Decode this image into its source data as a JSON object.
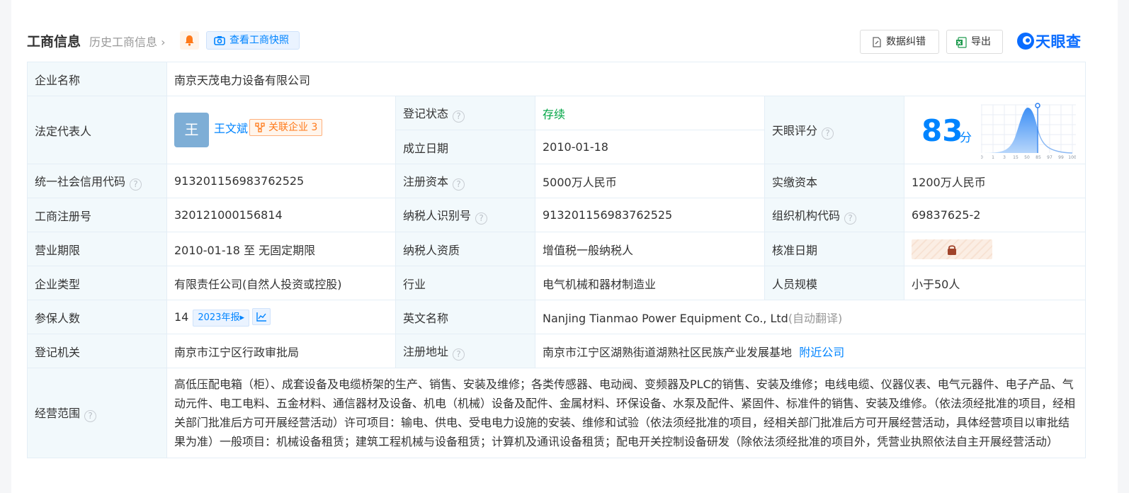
{
  "header": {
    "title": "工商信息",
    "history_link": "历史工商信息",
    "quick_view_label": "查看工商快照",
    "correct_label": "数据纠错",
    "export_label": "导出",
    "brand_name": "天眼查",
    "bell_icon": "bell-icon",
    "camera_icon": "camera-icon"
  },
  "rows": {
    "company_name": {
      "label": "企业名称",
      "value": "南京天茂电力设备有限公司"
    },
    "legal_rep": {
      "label": "法定代表人",
      "avatar_text": "王",
      "name": "王文斌",
      "related_label": "关联企业",
      "related_count": "3"
    },
    "reg_status": {
      "label": "登记状态",
      "value": "存续"
    },
    "found_date": {
      "label": "成立日期",
      "value": "2010-01-18"
    },
    "tianyan_score": {
      "label": "天眼评分",
      "score": "83",
      "unit": "分",
      "axis_ticks": [
        "0",
        "1",
        "3",
        "15",
        "50",
        "85",
        "97",
        "99",
        "100"
      ]
    },
    "credit_code": {
      "label": "统一社会信用代码",
      "value": "91320115698376252​5"
    },
    "reg_capital": {
      "label": "注册资本",
      "value": "5000万人民币"
    },
    "paid_capital": {
      "label": "实缴资本",
      "value": "1200万人民币"
    },
    "biz_reg_no": {
      "label": "工商注册号",
      "value": "320121000156814"
    },
    "taxpayer_id": {
      "label": "纳税人识别号",
      "value": "913201156983762525"
    },
    "org_code": {
      "label": "组织机构代码",
      "value": "69837625-2"
    },
    "biz_term": {
      "label": "营业期限",
      "value": "2010-01-18 至 无固定期限"
    },
    "taxpayer_qual": {
      "label": "纳税人资质",
      "value": "增值税一般纳税人"
    },
    "approve_date": {
      "label": "核准日期",
      "lock_icon": "lock-icon"
    },
    "company_type": {
      "label": "企业类型",
      "value": "有限责任公司(自然人投资或控股)"
    },
    "industry": {
      "label": "行业",
      "value": "电气机械和器材制造业"
    },
    "staff_size": {
      "label": "人员规模",
      "value": "小于50人"
    },
    "insured": {
      "label": "参保人数",
      "value": "14",
      "report_label": "2023年报"
    },
    "english_name": {
      "label": "英文名称",
      "value": "Nanjing Tianmao Power Equipment Co., Ltd",
      "note": "(自动翻译)"
    },
    "reg_authority": {
      "label": "登记机关",
      "value": "南京市江宁区行政审批局"
    },
    "reg_address": {
      "label": "注册地址",
      "value": "南京市江宁区湖熟街道湖熟社区民族产业发展基地",
      "nearby_label": "附近公司"
    },
    "biz_scope": {
      "label": "经营范围",
      "value": "高低压配电箱（柜）、成套设备及电缆桥架的生产、销售、安装及维修；各类传感器、电动阀、变频器及PLC的销售、安装及维修；电线电缆、仪器仪表、电气元器件、电子产品、气动元件、电工电料、五金材料、通信器材及设备、机电（机械）设备及配件、金属材料、环保设备、水泵及配件、紧固件、标准件的销售、安装及维修。（依法须经批准的项目，经相关部门批准后方可开展经营活动）许可项目：输电、供电、受电电力设施的安装、维修和试验（依法须经批准的项目，经相关部门批准后方可开展经营活动，具体经营项目以审批结果为准）一般项目：机械设备租赁；建筑工程机械与设备租赁；计算机及通讯设备租赁；配电开关控制设备研发（除依法须经批准的项目外，凭营业执照依法自主开展经营活动）"
    }
  },
  "colors": {
    "accent": "#0084ff",
    "status_green": "#00a544",
    "orange": "#ff7a1a",
    "label_bg": "#f2f9fc"
  }
}
